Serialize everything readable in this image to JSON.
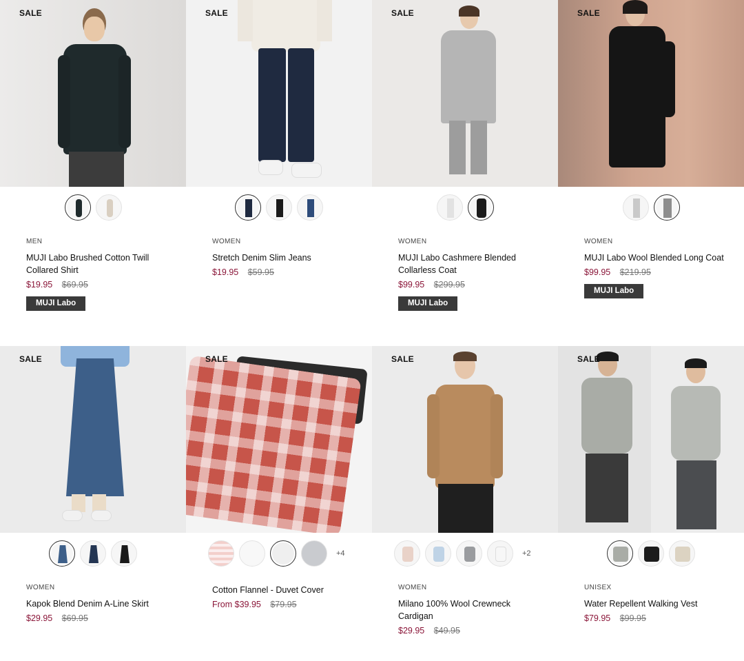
{
  "products": [
    {
      "sale_label": "SALE",
      "category": "MEN",
      "name": "MUJI Labo Brushed Cotton Twill Collared Shirt",
      "price": "$19.95",
      "original_price": "$69.95",
      "badge": "MUJI Labo",
      "swatches": [
        "dark-navy",
        "beige"
      ],
      "selected_swatch": 0,
      "more": ""
    },
    {
      "sale_label": "SALE",
      "category": "WOMEN",
      "name": "Stretch Denim Slim Jeans",
      "price": "$19.95",
      "original_price": "$59.95",
      "badge": "",
      "swatches": [
        "navy",
        "black",
        "blue"
      ],
      "selected_swatch": 0,
      "more": ""
    },
    {
      "sale_label": "SALE",
      "category": "WOMEN",
      "name": "MUJI Labo Cashmere Blended Collarless Coat",
      "price": "$99.95",
      "original_price": "$299.95",
      "badge": "MUJI Labo",
      "swatches": [
        "light-gray",
        "black"
      ],
      "selected_swatch": 1,
      "more": ""
    },
    {
      "sale_label": "SALE",
      "category": "WOMEN",
      "name": "MUJI Labo Wool Blended Long Coat",
      "price": "$99.95",
      "original_price": "$219.95",
      "badge": "MUJI Labo",
      "swatches": [
        "light-gray",
        "gray"
      ],
      "selected_swatch": 1,
      "more": ""
    },
    {
      "sale_label": "SALE",
      "category": "WOMEN",
      "name": "Kapok Blend Denim A-Line Skirt",
      "price": "$29.95",
      "original_price": "$69.95",
      "badge": "",
      "swatches": [
        "denim-blue",
        "dark-denim",
        "black"
      ],
      "selected_swatch": 0,
      "more": ""
    },
    {
      "sale_label": "SALE",
      "category": "",
      "name": "Cotton Flannel - Duvet Cover",
      "price": "From $39.95",
      "original_price": "$79.95",
      "badge": "",
      "swatches": [
        "pink-check",
        "white",
        "off-white",
        "gray"
      ],
      "selected_swatch": 2,
      "more": "+4"
    },
    {
      "sale_label": "SALE",
      "category": "WOMEN",
      "name": "Milano 100% Wool Crewneck Cardigan",
      "price": "$29.95",
      "original_price": "$49.95",
      "badge": "",
      "swatches": [
        "pink-beige",
        "light-blue",
        "gray",
        "white"
      ],
      "selected_swatch": -1,
      "more": "+2"
    },
    {
      "sale_label": "SALE",
      "category": "UNISEX",
      "name": "Water Repellent Walking Vest",
      "price": "$79.95",
      "original_price": "$99.95",
      "badge": "",
      "swatches": [
        "gray",
        "black",
        "beige"
      ],
      "selected_swatch": 0,
      "more": ""
    }
  ],
  "colors": {
    "sale_price": "#8a1538",
    "badge_bg": "#3a3a3a"
  }
}
